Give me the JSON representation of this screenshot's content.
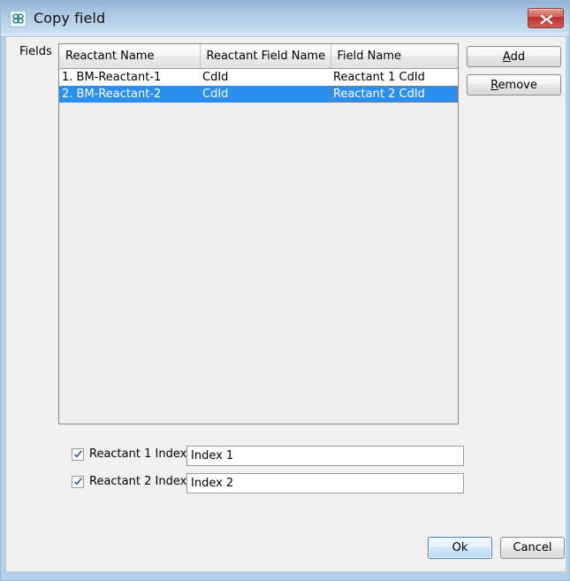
{
  "window": {
    "title": "Copy field",
    "icon": "molecule-icon",
    "close_label": "Close",
    "frame_color": "#b8cfe8",
    "titlebar_color": "#a2c0de",
    "body_color": "#f0f0f0"
  },
  "fields_section": {
    "label": "Fields",
    "table": {
      "columns": [
        "Reactant Name",
        "Reactant Field Name",
        "Field Name"
      ],
      "rows": [
        {
          "reactant_name": "1. BM-Reactant-1",
          "reactant_field_name": "CdId",
          "field_name": "Reactant 1 CdId",
          "selected": false
        },
        {
          "reactant_name": "2. BM-Reactant-2",
          "reactant_field_name": "CdId",
          "field_name": "Reactant 2 CdId",
          "selected": true
        }
      ],
      "selection_color": "#2a8fef"
    },
    "buttons": {
      "add": {
        "mnemonic": "A",
        "rest": "dd",
        "full": "Add"
      },
      "remove": {
        "mnemonic": "R",
        "rest": "emove",
        "full": "Remove"
      }
    }
  },
  "index_options": [
    {
      "checkbox_label": "Reactant 1 Index",
      "checked": true,
      "value": "Index 1",
      "placeholder": ""
    },
    {
      "checkbox_label": "Reactant 2 Index",
      "checked": true,
      "value": "Index 2",
      "placeholder": ""
    }
  ],
  "footer": {
    "ok_label": "Ok",
    "cancel_label": "Cancel",
    "default_button": "Ok",
    "default_accent": "#3c7fb1"
  }
}
